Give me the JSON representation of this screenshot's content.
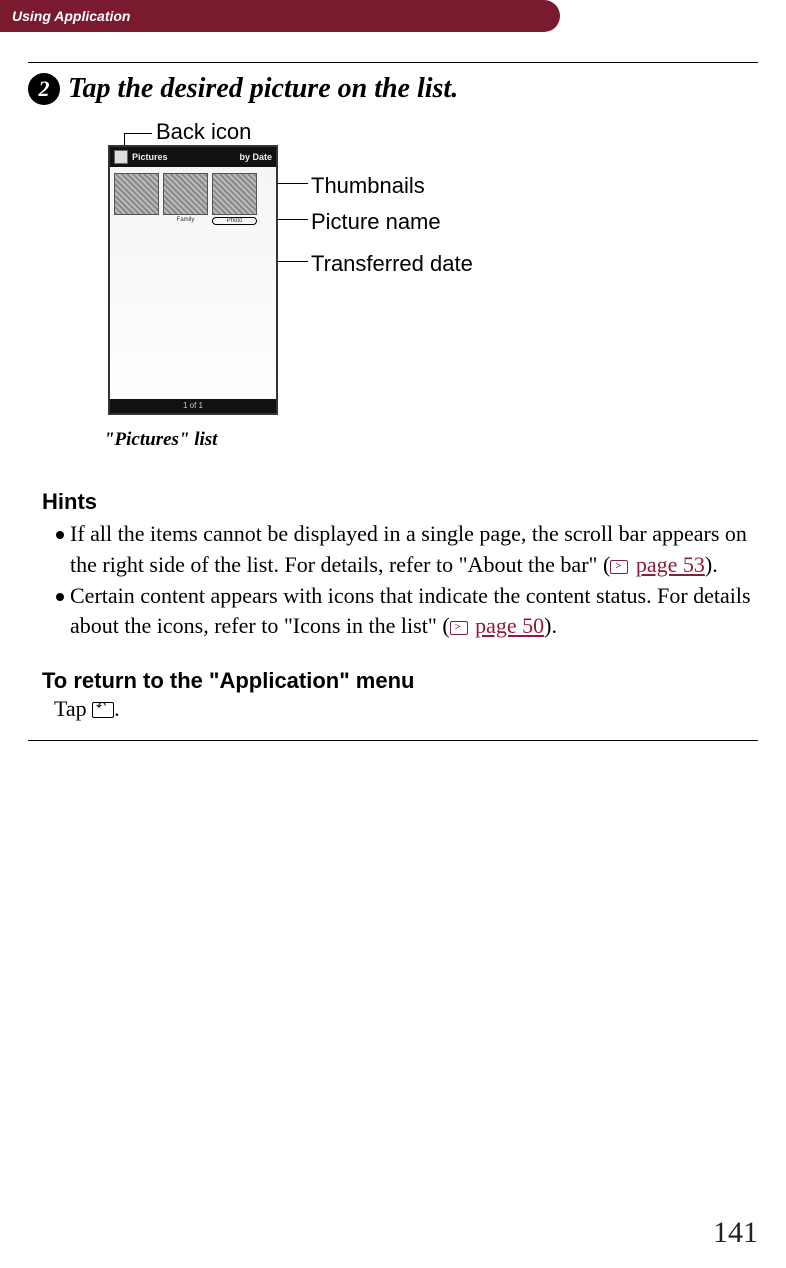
{
  "header": {
    "title": "Using Application"
  },
  "step": {
    "number": "2",
    "text": "Tap the desired picture on the list."
  },
  "callouts": {
    "back": "Back icon",
    "thumbs": "Thumbnails",
    "picname": "Picture name",
    "transdate": "Transferred date"
  },
  "screenshot": {
    "top_left": "Pictures",
    "top_right": "by Date",
    "caption": "\"Pictures\" list",
    "footer": "1 of 1"
  },
  "hints": {
    "title": "Hints",
    "items": [
      {
        "pre": "If all the items cannot be displayed in a single page,  the scroll bar appears on the right side of the list. For details, refer to \"About the bar\" (",
        "link": "page 53",
        "post": ")."
      },
      {
        "pre": "Certain content appears with icons that indicate the content status. For details about the icons, refer to \"Icons in the list\" (",
        "link": "page 50",
        "post": ")."
      }
    ]
  },
  "return_section": {
    "title": "To return to the \"Application\" menu",
    "pre": "Tap ",
    "post": "."
  },
  "page_number": "141"
}
